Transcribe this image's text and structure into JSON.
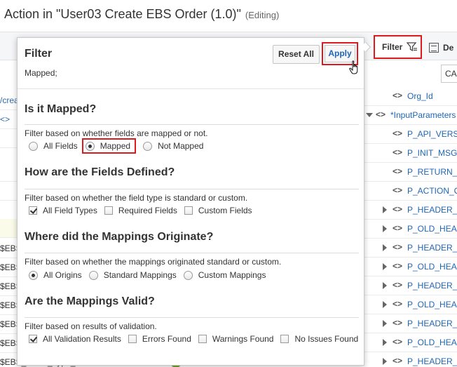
{
  "header": {
    "title": "Action in \"User03 Create EBS Order (1.0)\"",
    "status": "(Editing)"
  },
  "toolbar": {
    "filter_label": "Filter",
    "de_label": "De"
  },
  "search": {
    "value": "CA"
  },
  "background_left": {
    "rows": [
      "/crea",
      "<>",
      "",
      "",
      "",
      "",
      "$EBS",
      "$EBS",
      "$EBS",
      "$EBS",
      "$EBS",
      "$EBS",
      "$EBS"
    ]
  },
  "background_right": {
    "rows": [
      {
        "label": "Org_Id",
        "expander": "none",
        "icon": "<>"
      },
      {
        "label": "*InputParameters",
        "expander": "down",
        "icon": "<>"
      },
      {
        "label": "P_API_VERS",
        "expander": "none",
        "icon": "<>"
      },
      {
        "label": "P_INIT_MSG",
        "expander": "none",
        "icon": "<>"
      },
      {
        "label": "P_RETURN_",
        "expander": "none",
        "icon": "<>"
      },
      {
        "label": "P_ACTION_C",
        "expander": "none",
        "icon": "<>"
      },
      {
        "label": "P_HEADER_",
        "expander": "right",
        "icon": "<>"
      },
      {
        "label": "P_OLD_HEA",
        "expander": "right",
        "icon": "<>"
      },
      {
        "label": "P_HEADER_",
        "expander": "right",
        "icon": "<>"
      },
      {
        "label": "P_OLD_HEA",
        "expander": "right",
        "icon": "<>"
      },
      {
        "label": "P_HEADER_",
        "expander": "right",
        "icon": "<>"
      },
      {
        "label": "P_OLD_HEA",
        "expander": "right",
        "icon": "<>"
      },
      {
        "label": "P_HEADER_",
        "expander": "right",
        "icon": "<>"
      },
      {
        "label": "P_OLD_HEA",
        "expander": "right",
        "icon": "<>"
      },
      {
        "label": "P_HEADER_",
        "expander": "right",
        "icon": "<>"
      }
    ]
  },
  "bottom_row": {
    "label": "$EBS_Order_Type_ID"
  },
  "popup": {
    "title": "Filter",
    "summary": "Mapped;",
    "reset_label": "Reset All",
    "apply_label": "Apply",
    "sections": [
      {
        "title": "Is it Mapped?",
        "description": "Filter based on whether fields are mapped or not.",
        "control": "radio",
        "options": [
          {
            "label": "All Fields",
            "checked": false
          },
          {
            "label": "Mapped",
            "checked": true
          },
          {
            "label": "Not Mapped",
            "checked": false
          }
        ]
      },
      {
        "title": "How are the Fields Defined?",
        "description": "Filter based on whether the field type is standard or custom.",
        "control": "checkbox",
        "options": [
          {
            "label": "All Field Types",
            "checked": true
          },
          {
            "label": "Required Fields",
            "checked": false
          },
          {
            "label": "Custom Fields",
            "checked": false
          }
        ]
      },
      {
        "title": "Where did the Mappings Originate?",
        "description": "Filter based on whether the mappings originated standard or custom.",
        "control": "radio",
        "options": [
          {
            "label": "All Origins",
            "checked": true
          },
          {
            "label": "Standard Mappings",
            "checked": false
          },
          {
            "label": "Custom Mappings",
            "checked": false
          }
        ]
      },
      {
        "title": "Are the Mappings Valid?",
        "description": "Filter based on results of validation.",
        "control": "checkbox",
        "options": [
          {
            "label": "All Validation Results",
            "checked": true
          },
          {
            "label": "Errors Found",
            "checked": false
          },
          {
            "label": "Warnings Found",
            "checked": false
          },
          {
            "label": "No Issues Found",
            "checked": false
          }
        ]
      }
    ]
  },
  "colors": {
    "accent": "#1f66b5",
    "highlight": "#e0191e",
    "valid": "#6aaa2a"
  },
  "icons": [
    "filter-icon",
    "document-icon",
    "hand-cursor-icon",
    "check-icon"
  ]
}
